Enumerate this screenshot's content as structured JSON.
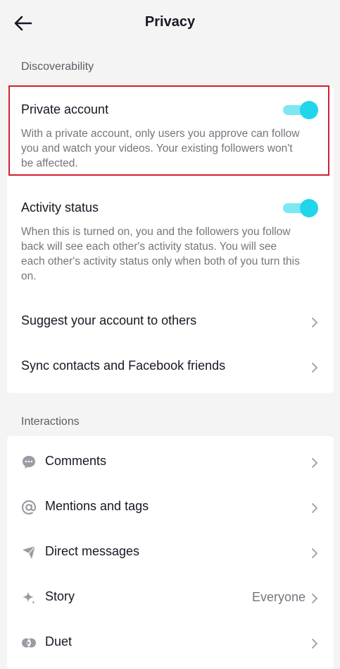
{
  "header": {
    "title": "Privacy"
  },
  "sections": {
    "discoverability": "Discoverability",
    "interactions": "Interactions"
  },
  "discoverability": {
    "private_account": {
      "title": "Private account",
      "desc": "With a private account, only users you approve can follow you and watch your videos. Your existing followers won't be affected.",
      "enabled": true
    },
    "activity_status": {
      "title": "Activity status",
      "desc": "When this is turned on, you and the followers you follow back will see each other's activity status. You will see each other's activity status only when both of you turn this on.",
      "enabled": true
    },
    "suggest_account": "Suggest your account to others",
    "sync_contacts": "Sync contacts and Facebook friends"
  },
  "interactions": {
    "comments": "Comments",
    "mentions": "Mentions and tags",
    "direct_messages": "Direct messages",
    "story": {
      "label": "Story",
      "value": "Everyone"
    },
    "duet": "Duet"
  },
  "colors": {
    "accent": "#20d5ec",
    "highlight": "#d0202f"
  }
}
